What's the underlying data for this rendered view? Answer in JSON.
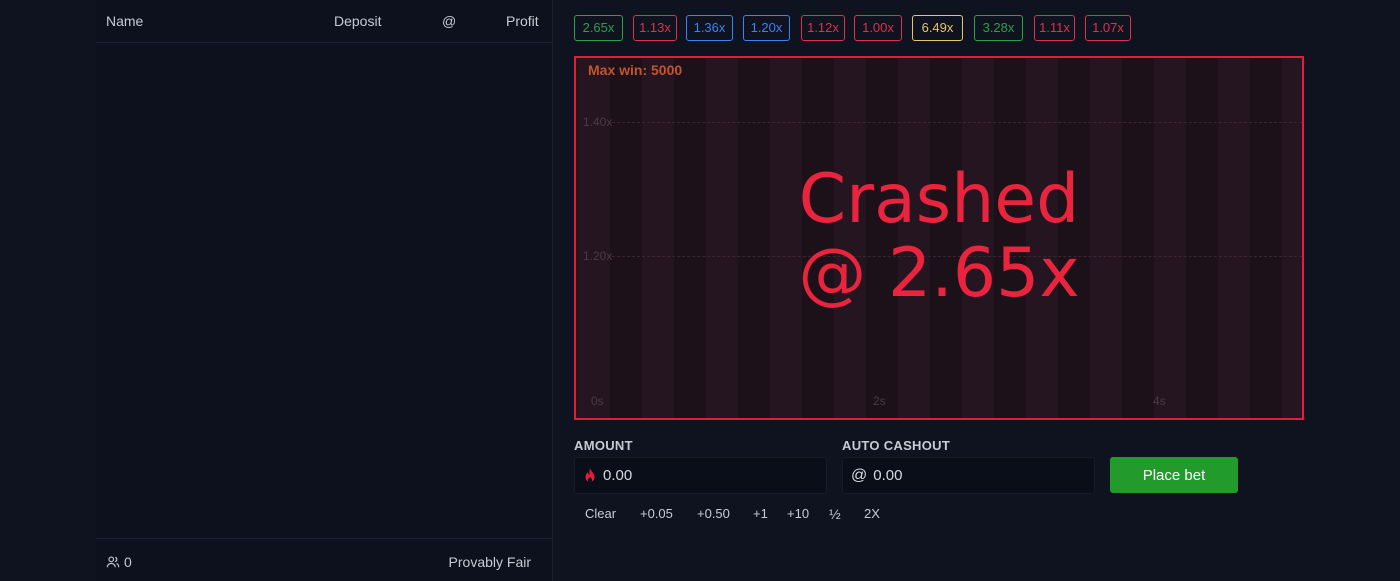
{
  "players": {
    "headers": {
      "name": "Name",
      "deposit": "Deposit",
      "at": "@",
      "profit": "Profit"
    },
    "count": "0",
    "provably_fair": "Provably Fair"
  },
  "history": [
    {
      "label": "2.65x",
      "color": "#2ea043"
    },
    {
      "label": "1.13x",
      "color": "#e0314b"
    },
    {
      "label": "1.36x",
      "color": "#3b82f6"
    },
    {
      "label": "1.20x",
      "color": "#3b82f6"
    },
    {
      "label": "1.12x",
      "color": "#e0314b"
    },
    {
      "label": "1.00x",
      "color": "#e0314b"
    },
    {
      "label": "6.49x",
      "color": "#e8c46a"
    },
    {
      "label": "3.28x",
      "color": "#2ea043"
    },
    {
      "label": "1.11x",
      "color": "#e0314b"
    },
    {
      "label": "1.07x",
      "color": "#e0314b"
    }
  ],
  "graph": {
    "max_win": "Max win: 5000",
    "crashed_line1": "Crashed",
    "crashed_line2": "@ 2.65x",
    "y_ticks": [
      "1.40x",
      "1.20x"
    ],
    "x_ticks": [
      "0s",
      "2s",
      "4s"
    ]
  },
  "controls": {
    "amount_label": "AMOUNT",
    "amount_value": "0.00",
    "auto_label": "AUTO CASHOUT",
    "auto_value": "0.00",
    "place_bet": "Place bet",
    "quick": [
      "Clear",
      "+0.05",
      "+0.50",
      "+1",
      "+10",
      "½",
      "2X"
    ]
  },
  "colors": {
    "accent_red": "#e21d3a",
    "bet_green": "#229a2c"
  }
}
